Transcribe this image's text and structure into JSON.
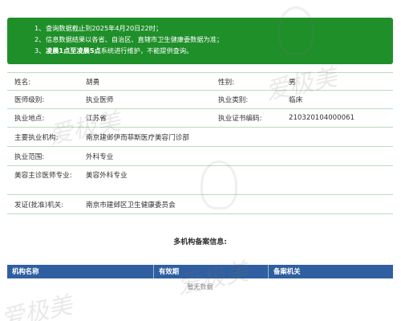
{
  "notice": {
    "lines": [
      {
        "num": "1、",
        "text": "查询数据截止到2025年4月20日22时；"
      },
      {
        "num": "2、",
        "text": "信息数据结果以各省、自治区、直辖市卫生健康委数据为准；"
      },
      {
        "num": "3、",
        "text_bold": "凌晨1点至凌晨5点",
        "text": "系统进行维护，不能提供查询。"
      }
    ]
  },
  "info": {
    "name_label": "姓名:",
    "name_value": "胡勇",
    "gender_label": "性别:",
    "gender_value": "男",
    "level_label": "医师级别:",
    "level_value": "执业医师",
    "category_label": "执业类别:",
    "category_value": "临床",
    "location_label": "执业地点:",
    "location_value": "江苏省",
    "cert_label": "执业证书编码:",
    "cert_value": "210320104000061",
    "org_label": "主要执业机构:",
    "org_value": "南京建邺伊而菲斯医疗美容门诊部",
    "scope_label": "执业范围:",
    "scope_value": "外科专业",
    "cosmetic_label": "美容主诊医师专业:",
    "cosmetic_value": "美容外科专业",
    "issuer_label": "发证(批准)机关:",
    "issuer_value": "南京市建邺区卫生健康委员会"
  },
  "multi_org": {
    "title": "多机构备案信息:",
    "columns": [
      "机构名称",
      "有效期",
      "备案机关"
    ],
    "empty_text": "暂无数据"
  },
  "watermark": {
    "text": "爱极美"
  }
}
